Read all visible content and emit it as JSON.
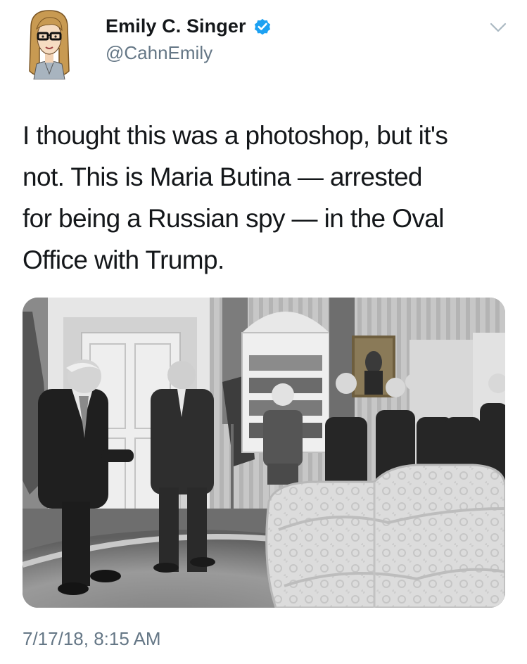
{
  "user": {
    "display_name": "Emily C. Singer",
    "handle": "@CahnEmily",
    "verified": true
  },
  "tweet": {
    "text": "I thought this was a photoshop, but it's\nnot. This is Maria Butina — arrested\nfor being a Russian spy — in the Oval\nOffice with Trump.",
    "timestamp": "7/17/18, 8:15 AM"
  },
  "icons": {
    "verified": "verified-badge-icon",
    "menu": "chevron-down-icon"
  },
  "colors": {
    "text_primary": "#14171a",
    "text_secondary": "#657786",
    "verified_blue": "#1da1f2",
    "chevron": "#aab8c2"
  }
}
